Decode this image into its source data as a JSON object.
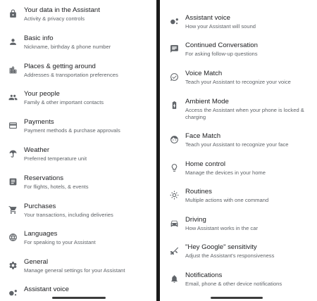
{
  "left_panel": {
    "items": [
      {
        "title": "Your data in the Assistant",
        "subtitle": "Activity & privacy controls",
        "icon": "lock-icon"
      },
      {
        "title": "Basic info",
        "subtitle": "Nickname, birthday & phone number",
        "icon": "person-icon"
      },
      {
        "title": "Places & getting around",
        "subtitle": "Addresses & transportation preferences",
        "icon": "places-icon"
      },
      {
        "title": "Your people",
        "subtitle": "Family & other important contacts",
        "icon": "people-icon"
      },
      {
        "title": "Payments",
        "subtitle": "Payment methods & purchase approvals",
        "icon": "credit-card-icon"
      },
      {
        "title": "Weather",
        "subtitle": "Preferred temperature unit",
        "icon": "weather-icon"
      },
      {
        "title": "Reservations",
        "subtitle": "For flights, hotels, & events",
        "icon": "reservations-icon"
      },
      {
        "title": "Purchases",
        "subtitle": "Your transactions, including deliveries",
        "icon": "cart-icon"
      },
      {
        "title": "Languages",
        "subtitle": "For speaking to your Assistant",
        "icon": "globe-icon"
      },
      {
        "title": "General",
        "subtitle": "Manage general settings for your Assistant",
        "icon": "gear-icon"
      },
      {
        "title": "Assistant voice",
        "subtitle": "",
        "icon": "assistant-voice-icon"
      }
    ]
  },
  "right_panel": {
    "items": [
      {
        "title": "Assistant voice",
        "subtitle": "How your Assistant will sound",
        "icon": "assistant-voice-icon"
      },
      {
        "title": "Continued Conversation",
        "subtitle": "For asking follow-up questions",
        "icon": "chat-icon"
      },
      {
        "title": "Voice Match",
        "subtitle": "Teach your Assistant to recognize your voice",
        "icon": "voice-match-icon"
      },
      {
        "title": "Ambient Mode",
        "subtitle": "Access the Assistant when your phone is locked & charging",
        "icon": "battery-charging-icon"
      },
      {
        "title": "Face Match",
        "subtitle": "Teach your Assistant to recognize your face",
        "icon": "face-icon"
      },
      {
        "title": "Home control",
        "subtitle": "Manage the devices in your home",
        "icon": "lightbulb-icon"
      },
      {
        "title": "Routines",
        "subtitle": "Multiple actions with one command",
        "icon": "routines-icon"
      },
      {
        "title": "Driving",
        "subtitle": "How Assistant works in the car",
        "icon": "car-icon"
      },
      {
        "title": "\"Hey Google\" sensitivity",
        "subtitle": "Adjust the Assistant's responsiveness",
        "icon": "sensitivity-icon"
      },
      {
        "title": "Notifications",
        "subtitle": "Email, phone & other device notifications",
        "icon": "bell-icon"
      }
    ]
  }
}
